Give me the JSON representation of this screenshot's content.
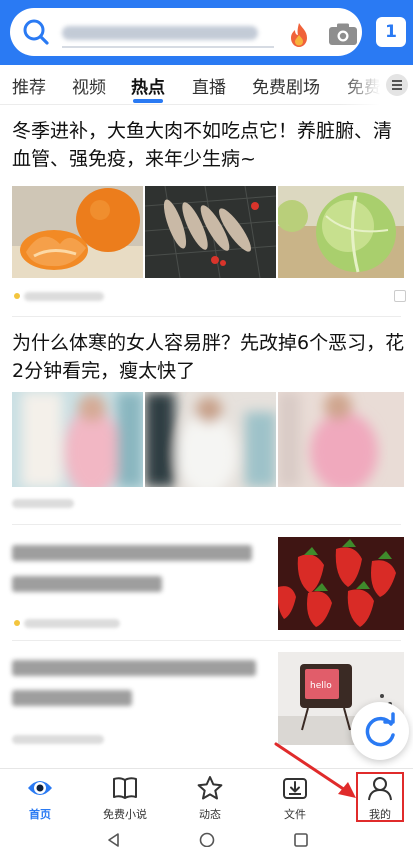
{
  "header": {
    "tabs_count": "1",
    "icons": {
      "search": "search-icon",
      "hot": "fire-icon",
      "camera": "camera-icon"
    }
  },
  "channels": [
    {
      "label": "推荐"
    },
    {
      "label": "视频"
    },
    {
      "label": "热点",
      "active": true
    },
    {
      "label": "直播"
    },
    {
      "label": "免费剧场"
    },
    {
      "label": "免费"
    }
  ],
  "feed": {
    "article1": {
      "title": "冬季进补，大鱼大肉不如吃点它！养脏腑、清血管、强免疫，来年少生病~"
    },
    "article2": {
      "title": "为什么体寒的女人容易胖？先改掉6个恶习，花2分钟看完，瘦太快了"
    },
    "article4": {
      "tv_text": "hello"
    }
  },
  "bottom_nav": {
    "items": [
      {
        "label": "首页",
        "icon": "eye-icon",
        "active": true
      },
      {
        "label": "免费小说",
        "icon": "book-icon"
      },
      {
        "label": "动态",
        "icon": "star-icon"
      },
      {
        "label": "文件",
        "icon": "download-box-icon"
      },
      {
        "label": "我的",
        "icon": "user-icon"
      }
    ]
  },
  "colors": {
    "brand": "#2a7af3",
    "annotation": "#e02b2b"
  }
}
